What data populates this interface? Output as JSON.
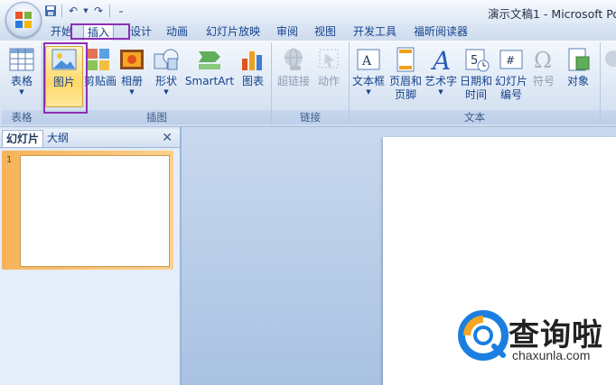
{
  "title_bar": {
    "document_title": "演示文稿1 - Microsoft Po"
  },
  "quick_access": {
    "save_icon": "save-icon",
    "undo_icon": "undo-icon",
    "redo_icon": "redo-icon",
    "customize_icon": "customize-qat-icon"
  },
  "tabs": [
    {
      "label": "开始"
    },
    {
      "label": "插入"
    },
    {
      "label": "设计"
    },
    {
      "label": "动画"
    },
    {
      "label": "幻灯片放映"
    },
    {
      "label": "审阅"
    },
    {
      "label": "视图"
    },
    {
      "label": "开发工具"
    },
    {
      "label": "福昕阅读器"
    }
  ],
  "active_tab": "插入",
  "ribbon": {
    "groups": {
      "table": {
        "label": "表格",
        "button": "表格"
      },
      "illustrations": {
        "label": "插图",
        "picture": "图片",
        "clipart": "剪贴画",
        "album": "相册",
        "shapes": "形状",
        "smartart": "SmartArt",
        "chart": "图表"
      },
      "links": {
        "label": "链接",
        "hyperlink": "超链接",
        "action": "动作"
      },
      "text": {
        "label": "文本",
        "textbox": "文本框",
        "header_footer_1": "页眉和",
        "header_footer_2": "页脚",
        "wordart": "艺术字",
        "datetime_1": "日期和",
        "datetime_2": "时间",
        "slide_number_1": "幻灯片",
        "slide_number_2": "编号",
        "symbol": "符号",
        "object": "对象"
      }
    }
  },
  "colors": {
    "highlight": "#8d2fb3",
    "ribbon_text": "#15428b",
    "slide_selected": "#f7b35a"
  },
  "slides_panel": {
    "tab_slides": "幻灯片",
    "tab_outline": "大纲",
    "close_glyph": "✕",
    "slide_number": "1"
  },
  "watermark": {
    "chinese": "查询啦",
    "domain": "chaxunla.com"
  }
}
